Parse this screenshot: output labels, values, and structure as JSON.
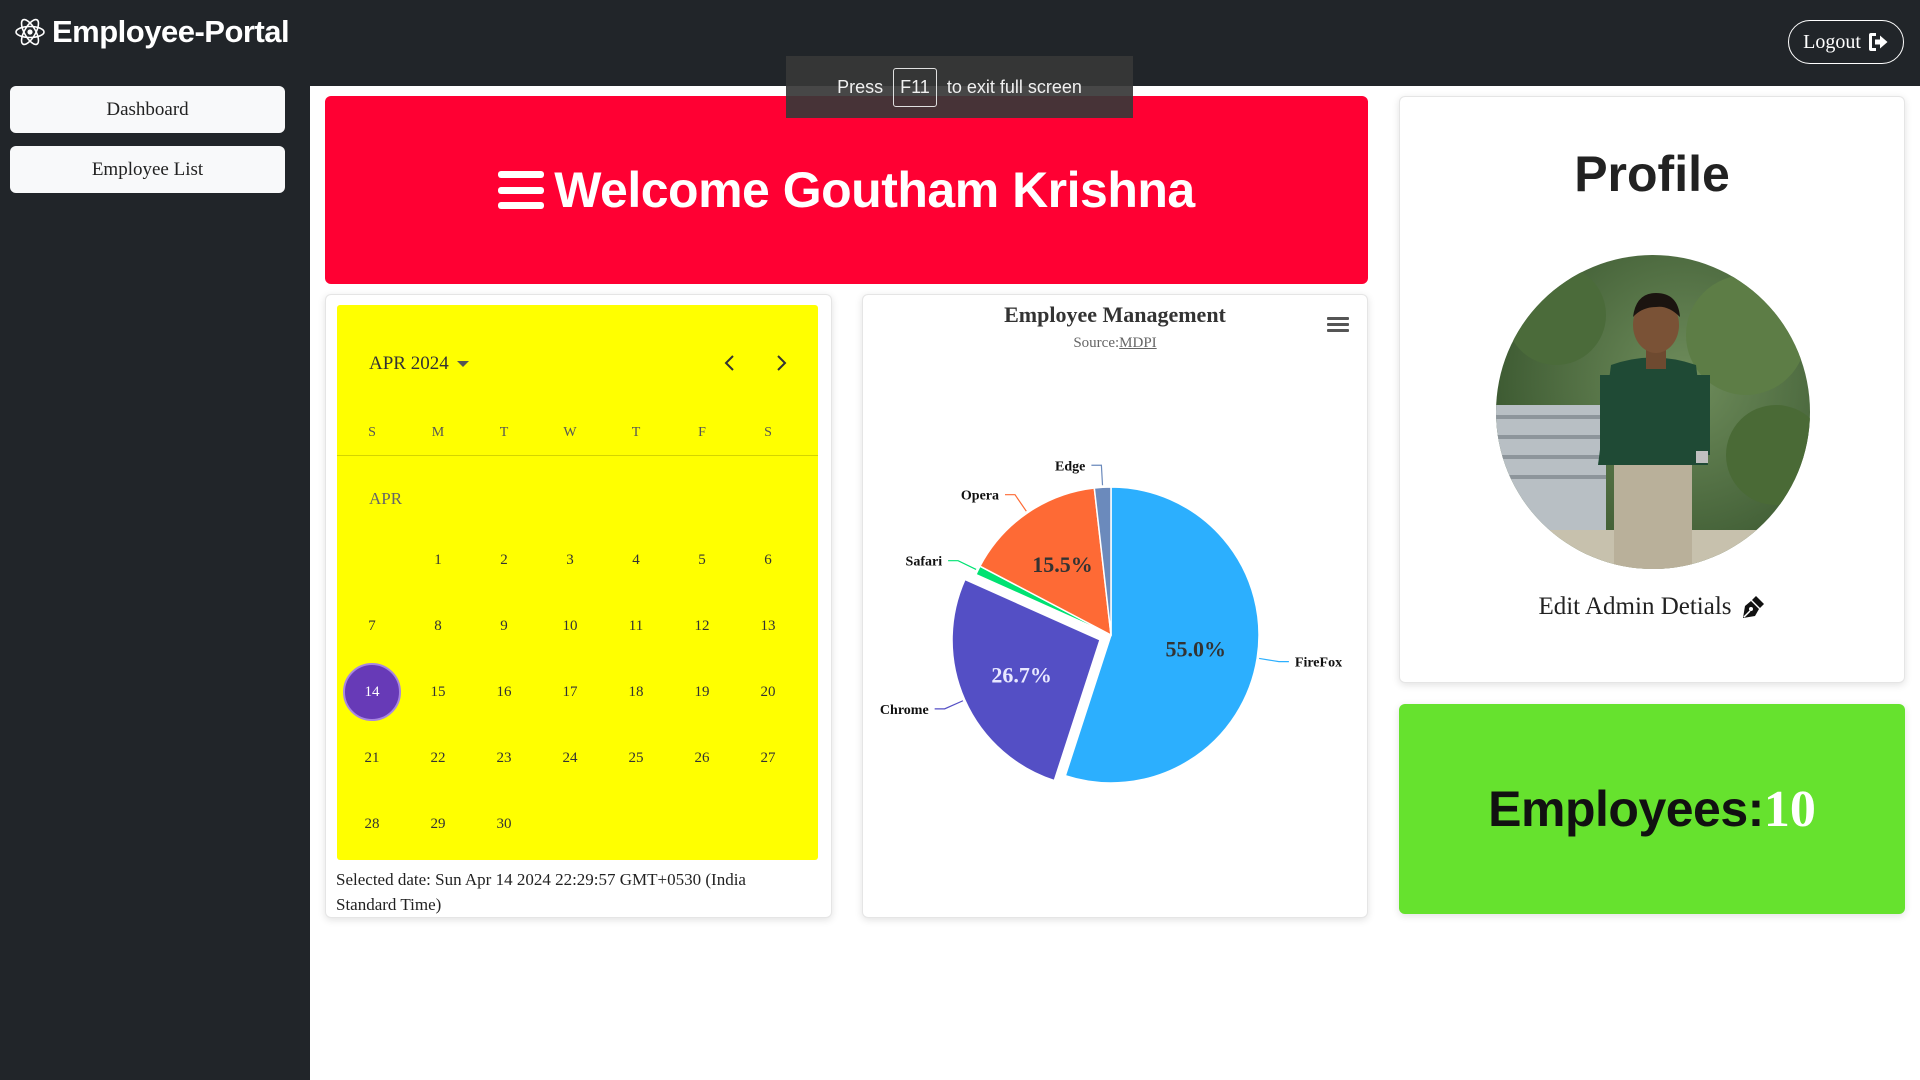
{
  "app": {
    "brand": "Employee-Portal",
    "logout_label": "Logout"
  },
  "sidebar": {
    "items": [
      {
        "label": "Dashboard"
      },
      {
        "label": "Employee List"
      }
    ]
  },
  "toast": {
    "press": "Press",
    "key": "F11",
    "suffix": "to exit full screen"
  },
  "welcome": {
    "text": "Welcome Goutham Krishna",
    "color": "#ff0033"
  },
  "calendar": {
    "month_year": "APR 2024",
    "weekdays": [
      "S",
      "M",
      "T",
      "W",
      "T",
      "F",
      "S"
    ],
    "month_label": "APR",
    "days": [
      "1",
      "2",
      "3",
      "4",
      "5",
      "6",
      "7",
      "8",
      "9",
      "10",
      "11",
      "12",
      "13",
      "14",
      "15",
      "16",
      "17",
      "18",
      "19",
      "20",
      "21",
      "22",
      "23",
      "24",
      "25",
      "26",
      "27",
      "28",
      "29",
      "30"
    ],
    "first_weekday": 1,
    "selected_day": "14",
    "selected_text": "Selected date: Sun Apr 14 2024 22:29:57 GMT+0530 (India Standard Time)",
    "background": "#ffff00",
    "accent": "#673ab7"
  },
  "chart_data": {
    "type": "pie",
    "title": "Employee Management",
    "subtitle_prefix": "Source:",
    "subtitle_link": "MDPI",
    "slices": [
      {
        "name": "FireFox",
        "value": 55.0,
        "label": "55.0%",
        "color": "#2caffe"
      },
      {
        "name": "Chrome",
        "value": 26.7,
        "label": "26.7%",
        "color": "#544fc5",
        "sliced": true
      },
      {
        "name": "Safari",
        "value": 1.0,
        "label": "",
        "color": "#00e272"
      },
      {
        "name": "Opera",
        "value": 15.5,
        "label": "15.5%",
        "color": "#fe6a35"
      },
      {
        "name": "Edge",
        "value": 1.8,
        "label": "",
        "color": "#6b8abc"
      }
    ]
  },
  "profile": {
    "title": "Profile",
    "edit_label": "Edit Admin Detials"
  },
  "employees": {
    "label": "Employees:",
    "count": "10",
    "color": "#66e22e"
  }
}
